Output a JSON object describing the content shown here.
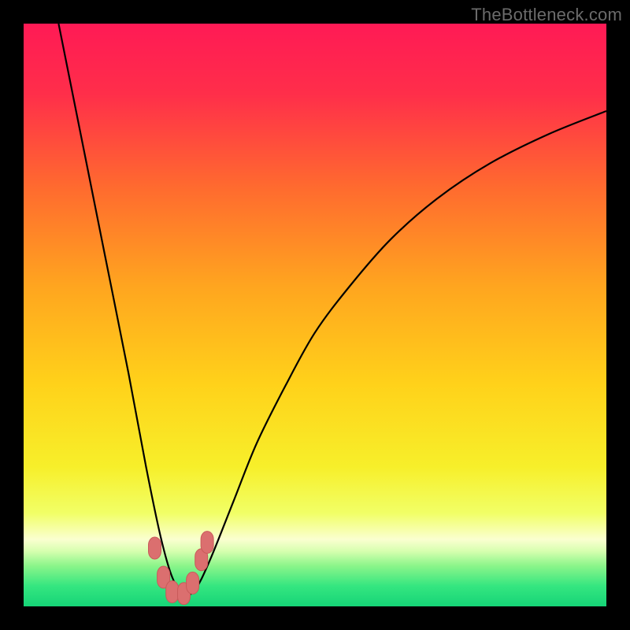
{
  "watermark": "TheBottleneck.com",
  "colors": {
    "frame": "#000000",
    "curve": "#000000",
    "marker_fill": "#db6f6f",
    "marker_stroke": "#c95a5a",
    "gradient_stops": [
      {
        "offset": 0.0,
        "color": "#ff1a55"
      },
      {
        "offset": 0.12,
        "color": "#ff2e4a"
      },
      {
        "offset": 0.28,
        "color": "#ff6a2f"
      },
      {
        "offset": 0.45,
        "color": "#ffa51f"
      },
      {
        "offset": 0.62,
        "color": "#ffd21a"
      },
      {
        "offset": 0.76,
        "color": "#f7ef2a"
      },
      {
        "offset": 0.84,
        "color": "#f1ff66"
      },
      {
        "offset": 0.885,
        "color": "#faffd0"
      },
      {
        "offset": 0.905,
        "color": "#d7ffb0"
      },
      {
        "offset": 0.93,
        "color": "#8cf58a"
      },
      {
        "offset": 0.965,
        "color": "#35e680"
      },
      {
        "offset": 1.0,
        "color": "#15d477"
      }
    ]
  },
  "chart_data": {
    "type": "line",
    "title": "",
    "xlabel": "",
    "ylabel": "",
    "xlim": [
      0,
      100
    ],
    "ylim": [
      0,
      100
    ],
    "grid": false,
    "series": [
      {
        "name": "bottleneck-curve",
        "x": [
          6,
          10,
          14,
          18,
          21,
          23.5,
          25.5,
          27.5,
          29.5,
          32,
          36,
          40,
          45,
          50,
          56,
          63,
          71,
          80,
          90,
          100
        ],
        "y": [
          100,
          80,
          60,
          40,
          24,
          12,
          5,
          2,
          3,
          8,
          18,
          28,
          38,
          47,
          55,
          63,
          70,
          76,
          81,
          85
        ]
      }
    ],
    "markers": {
      "name": "highlighted-segment",
      "points": [
        {
          "x": 22.5,
          "y": 10
        },
        {
          "x": 24.0,
          "y": 5
        },
        {
          "x": 25.5,
          "y": 2.5
        },
        {
          "x": 27.5,
          "y": 2.2
        },
        {
          "x": 29.0,
          "y": 4
        },
        {
          "x": 30.5,
          "y": 8
        },
        {
          "x": 31.5,
          "y": 11
        }
      ]
    }
  }
}
